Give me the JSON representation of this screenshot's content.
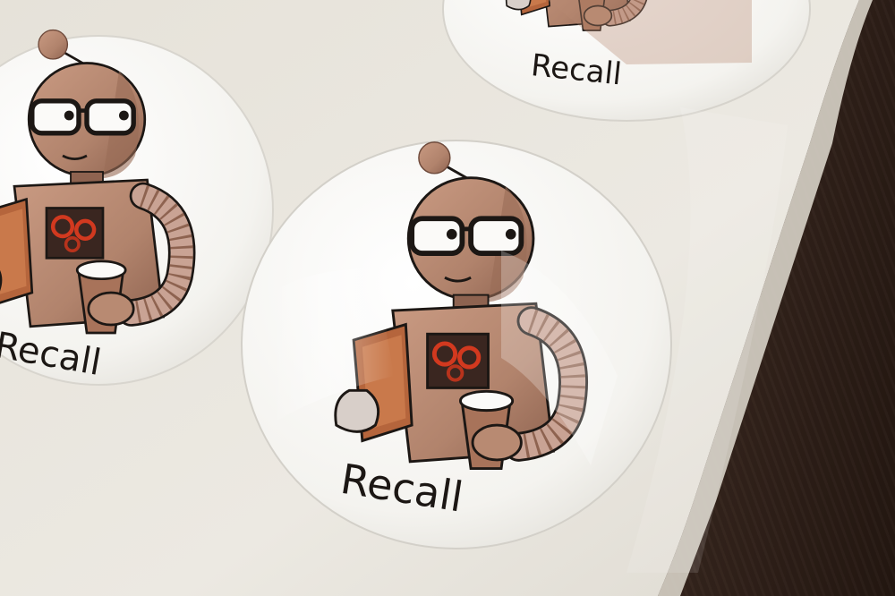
{
  "stickers": [
    {
      "id": "top-right",
      "label": "Recall"
    },
    {
      "id": "left",
      "label": "Recall"
    },
    {
      "id": "center",
      "label": "Recall"
    }
  ],
  "colors": {
    "sheet": "#ece9e1",
    "sticker": "#f7f6f3",
    "robot_copper": "#b88a72",
    "robot_shadow": "#8c6552",
    "outline": "#1c1714",
    "gear": "#d2391f",
    "wood": "#2f1f18"
  },
  "icons": [
    "robot-illustration",
    "book-icon",
    "coffee-cup-icon",
    "gear-icon",
    "glasses-icon"
  ]
}
